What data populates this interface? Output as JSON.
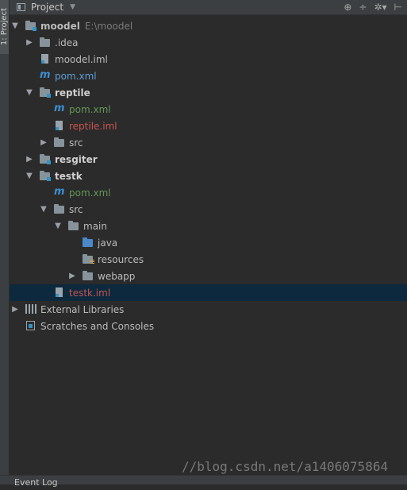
{
  "side_tab": {
    "label": "1: Project"
  },
  "header": {
    "title": "Project",
    "tools": [
      "globe-icon",
      "collapse-icon",
      "gear-icon",
      "hide-icon"
    ]
  },
  "tree": [
    {
      "label": "moodel",
      "path": "E:\\moodel",
      "bold": true,
      "arrow": "down",
      "icon": "folder-module",
      "color": "#bbbbbb"
    },
    {
      "label": ".idea",
      "arrow": "right",
      "icon": "folder",
      "color": "#bbbbbb"
    },
    {
      "label": "moodel.iml",
      "icon": "iml",
      "color": "#bbbbbb"
    },
    {
      "label": "pom.xml",
      "icon": "maven",
      "color": "#5e9ed6"
    },
    {
      "label": "reptile",
      "bold": true,
      "arrow": "down",
      "icon": "folder-module",
      "color": "#d0d0d0"
    },
    {
      "label": "pom.xml",
      "icon": "maven",
      "color": "#629755"
    },
    {
      "label": "reptile.iml",
      "icon": "iml",
      "color": "#c75450"
    },
    {
      "label": "src",
      "arrow": "right",
      "icon": "folder",
      "color": "#bbbbbb"
    },
    {
      "label": "resgiter",
      "bold": true,
      "arrow": "right",
      "icon": "folder-module",
      "color": "#d0d0d0"
    },
    {
      "label": "testk",
      "bold": true,
      "arrow": "down",
      "icon": "folder-module",
      "color": "#d0d0d0"
    },
    {
      "label": "pom.xml",
      "icon": "maven",
      "color": "#629755"
    },
    {
      "label": "src",
      "arrow": "down",
      "icon": "folder",
      "color": "#bbbbbb"
    },
    {
      "label": "main",
      "arrow": "down",
      "icon": "folder",
      "color": "#bbbbbb"
    },
    {
      "label": "java",
      "icon": "folder-source",
      "color": "#bbbbbb"
    },
    {
      "label": "resources",
      "icon": "folder-resources",
      "color": "#bbbbbb"
    },
    {
      "label": "webapp",
      "arrow": "right",
      "icon": "folder",
      "color": "#bbbbbb"
    },
    {
      "label": "testk.iml",
      "icon": "iml",
      "color": "#c75450",
      "selected": true
    },
    {
      "label": "External Libraries",
      "arrow": "right",
      "icon": "libraries",
      "color": "#bbbbbb"
    },
    {
      "label": "Scratches and Consoles",
      "icon": "scratches",
      "color": "#bbbbbb"
    }
  ],
  "watermark": "//blog.csdn.net/a1406075864",
  "bottom_bar": {
    "label": "Event Log"
  }
}
